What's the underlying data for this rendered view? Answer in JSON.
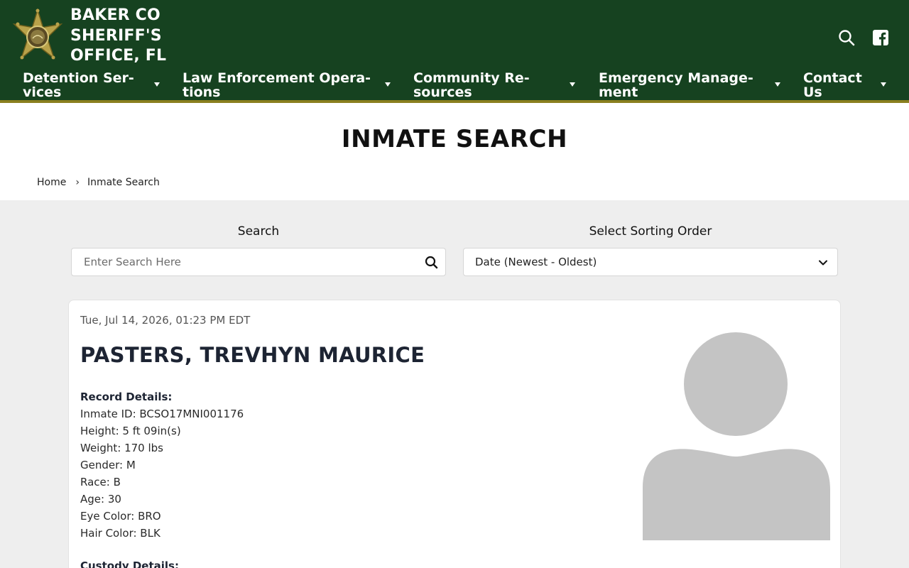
{
  "header": {
    "title_lines": [
      "BAKER CO",
      "SHERIFF'S",
      "OFFICE, FL"
    ],
    "colors": {
      "header_bg": "#164220",
      "accent_gold": "#8a7f1f",
      "badge_gold": "#b8a24a"
    },
    "icons": {
      "search": "search-icon",
      "facebook": "facebook-icon",
      "logo": "sheriff-star-badge"
    }
  },
  "nav": {
    "items": [
      {
        "line1": "Detention Ser-",
        "line2": "vices"
      },
      {
        "line1": "Law Enforcement Opera-",
        "line2": "tions"
      },
      {
        "line1": "Community Re-",
        "line2": "sources"
      },
      {
        "line1": "Emergency Manage-",
        "line2": "ment"
      },
      {
        "line1": "Contact",
        "line2": "Us"
      }
    ]
  },
  "page": {
    "title": "INMATE SEARCH",
    "breadcrumb": {
      "home": "Home",
      "separator": "›",
      "current": "Inmate Search"
    }
  },
  "search": {
    "label": "Search",
    "placeholder": "Enter Search Here",
    "value": ""
  },
  "sort": {
    "label": "Select Sorting Order",
    "selected": "Date (Newest - Oldest)"
  },
  "record": {
    "date": "Tue, Jul 14, 2026, 01:23 PM EDT",
    "name": "PASTERS, TREVHYN MAURICE",
    "record_details_heading": "Record Details:",
    "details": [
      "Inmate ID: BCSO17MNI001176",
      "Height: 5 ft 09in(s)",
      "Weight: 170 lbs",
      "Gender: M",
      "Race: B",
      "Age: 30",
      "Eye Color: BRO",
      "Hair Color: BLK"
    ],
    "custody_details_heading": "Custody Details:",
    "avatar_icon": "person-placeholder-icon"
  }
}
